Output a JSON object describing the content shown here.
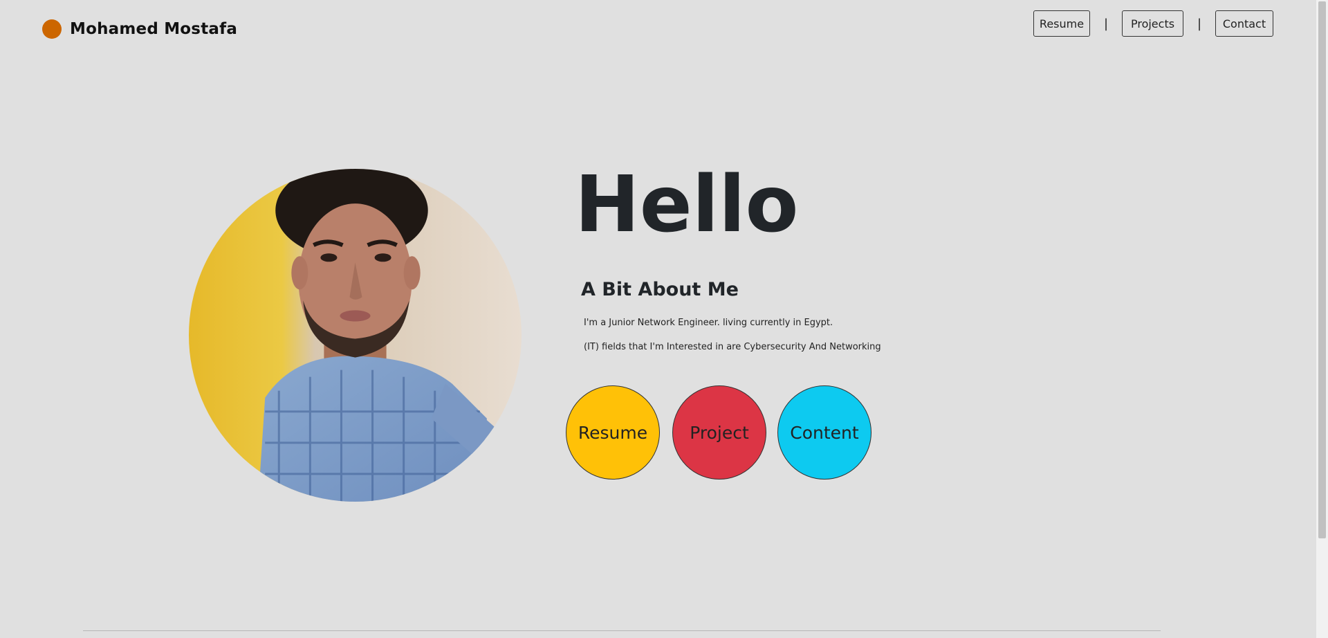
{
  "header": {
    "brand_name": "Mohamed Mostafa",
    "nav": [
      {
        "label": "Resume"
      },
      {
        "label": "Projects"
      },
      {
        "label": "Contact"
      }
    ],
    "separator": "|"
  },
  "hero": {
    "greeting": "Hello",
    "about_title": "A Bit About Me",
    "about_lines": [
      "I'm a Junior Network Engineer. living currently in Egypt.",
      "(IT) fields that I'm Interested in are Cybersecurity And Networking"
    ],
    "buttons": [
      {
        "label": "Resume",
        "color": "#ffc107"
      },
      {
        "label": "Project",
        "color": "#dc3545"
      },
      {
        "label": "Content",
        "color": "#0dcaf0"
      }
    ]
  },
  "colors": {
    "background": "#e0e0e0",
    "brand_dot": "#cc6600",
    "text": "#212529"
  },
  "icons": {
    "brand": "orange-dot-icon",
    "profile_photo": "profile-photo"
  }
}
